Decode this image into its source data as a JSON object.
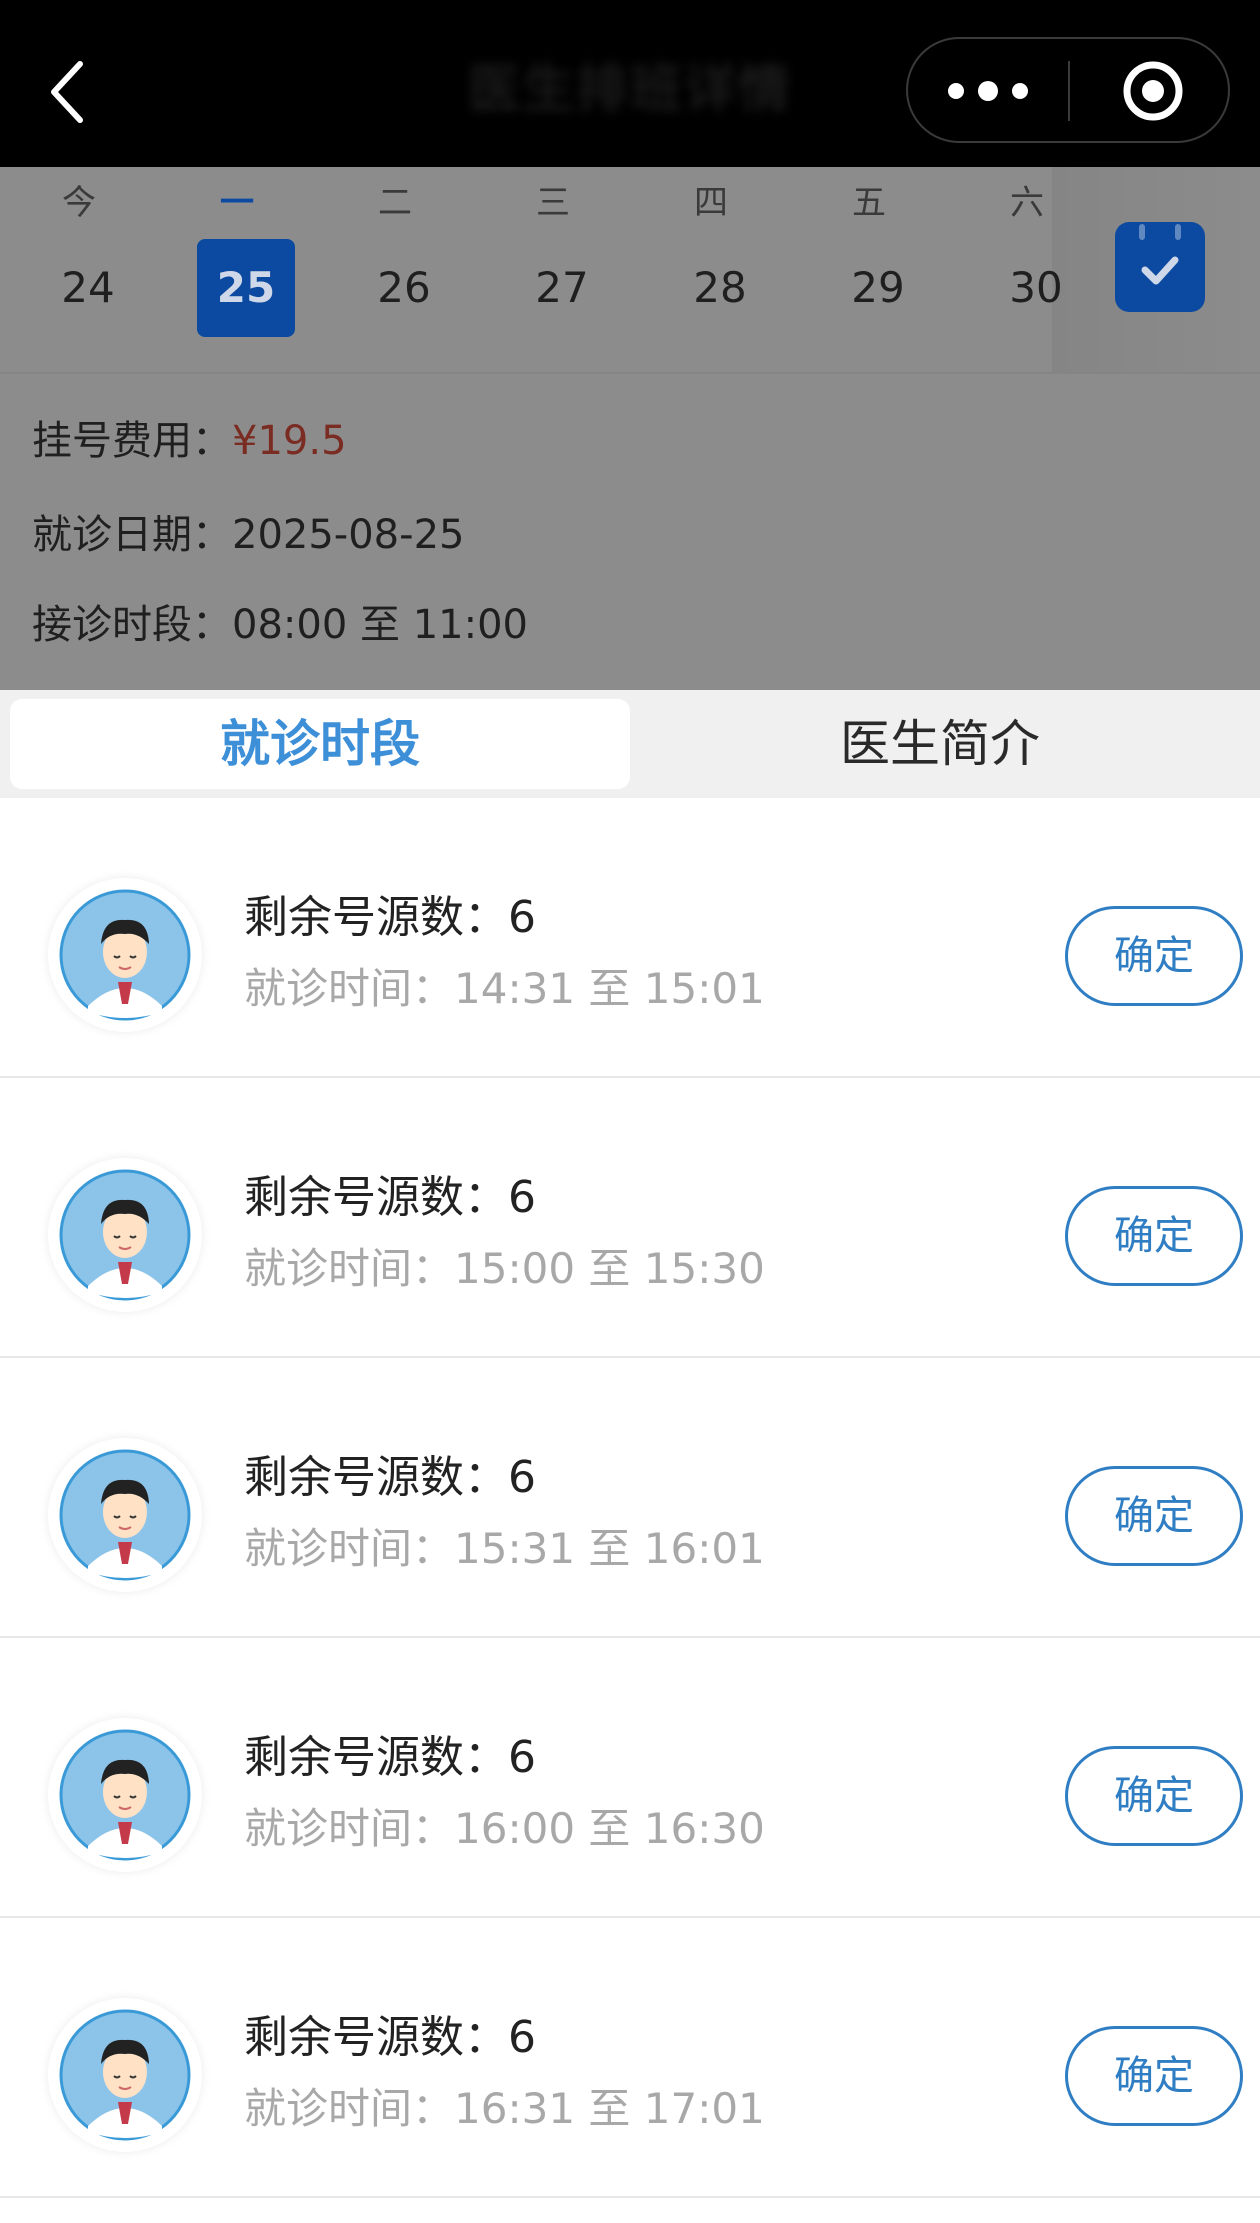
{
  "header": {
    "title": "医生排班详情",
    "back_icon": "chevron-left-icon",
    "more_icon": "more-dots-icon",
    "scan_icon": "target-icon"
  },
  "week": {
    "days": [
      {
        "weekday": "今",
        "date": "24"
      },
      {
        "weekday": "一",
        "date": "25"
      },
      {
        "weekday": "二",
        "date": "26"
      },
      {
        "weekday": "三",
        "date": "27"
      },
      {
        "weekday": "四",
        "date": "28"
      },
      {
        "weekday": "五",
        "date": "29"
      },
      {
        "weekday": "六",
        "date": "30"
      }
    ],
    "selected_index": 1,
    "calendar_icon": "calendar-check-icon"
  },
  "info": {
    "fee_label": "挂号费用：",
    "fee_value": "¥19.5",
    "date_label": "就诊日期：",
    "date_value": "2025-08-25",
    "period_label": "接诊时段：",
    "period_value": "08:00 至 11:00"
  },
  "tabs": {
    "active": "就诊时段",
    "inactive": "医生简介"
  },
  "slots": [
    {
      "count_label": "剩余号源数：",
      "count": "6",
      "time_label": "就诊时间：",
      "time": "14:31 至 15:01",
      "button": "确定"
    },
    {
      "count_label": "剩余号源数：",
      "count": "6",
      "time_label": "就诊时间：",
      "time": "15:00 至 15:30",
      "button": "确定"
    },
    {
      "count_label": "剩余号源数：",
      "count": "6",
      "time_label": "就诊时间：",
      "time": "15:31 至 16:01",
      "button": "确定"
    },
    {
      "count_label": "剩余号源数：",
      "count": "6",
      "time_label": "就诊时间：",
      "time": "16:00 至 16:30",
      "button": "确定"
    },
    {
      "count_label": "剩余号源数：",
      "count": "6",
      "time_label": "就诊时间：",
      "time": "16:31 至 17:01",
      "button": "确定"
    }
  ],
  "colors": {
    "accent": "#0b4aa0",
    "tab_active": "#3d8fd8",
    "price": "#b03a2e",
    "button": "#2f7ec4"
  }
}
